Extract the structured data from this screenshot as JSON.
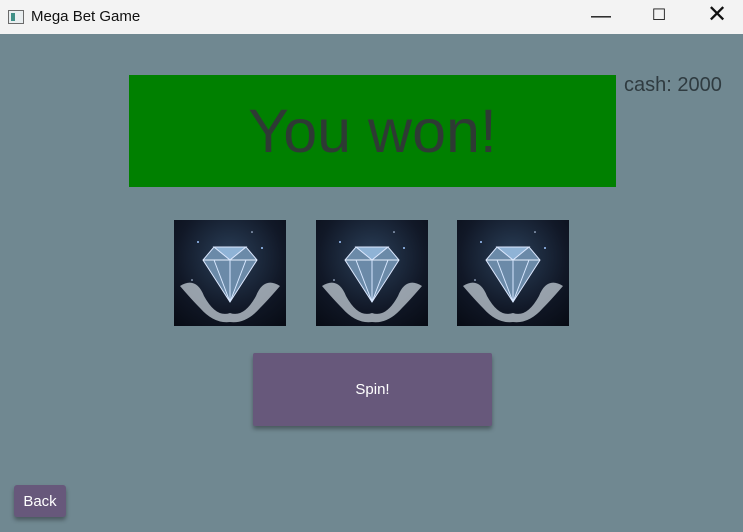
{
  "window": {
    "title": "Mega Bet Game",
    "controls": {
      "minimize": "—",
      "maximize": "☐",
      "close": "✕"
    }
  },
  "game": {
    "result_text": "You won!",
    "cash_text": "cash: 2000",
    "reels": [
      {
        "symbol": "diamond-icon"
      },
      {
        "symbol": "diamond-icon"
      },
      {
        "symbol": "diamond-icon"
      }
    ],
    "spin_label": "Spin!",
    "back_label": "Back"
  },
  "colors": {
    "background": "#708891",
    "banner": "#008000",
    "button": "#67587b"
  }
}
